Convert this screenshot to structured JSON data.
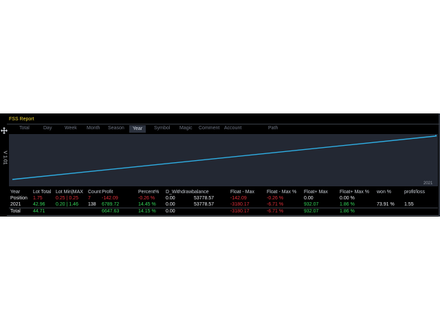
{
  "window": {
    "title": "FSS Report",
    "side_label": "V 1.01"
  },
  "tabs": [
    {
      "label": "Total"
    },
    {
      "label": "Day"
    },
    {
      "label": "Week"
    },
    {
      "label": "Month"
    },
    {
      "label": "Season"
    },
    {
      "label": "Year",
      "active": true
    },
    {
      "label": "Symbol"
    },
    {
      "label": "Magic"
    },
    {
      "label": "Comment"
    },
    {
      "label": "Account"
    },
    {
      "label": "Path"
    }
  ],
  "chart": {
    "x_tick": "2021",
    "line_color": "#2fb0e6",
    "trend": "rising"
  },
  "table": {
    "headers": [
      "Year",
      "Lot Total",
      "Lot Min|MAX",
      "Count",
      "Profit",
      "Percent%",
      "D_Withdrawbalance",
      "Float - Max",
      "Float - Max %",
      "Float+ Max",
      "Float+ Max %",
      "won %",
      "profit/loss"
    ],
    "rows": [
      {
        "cells": [
          "Position",
          "1.75",
          "0.25 | 0.25",
          "7",
          "-142.09",
          "-0.26 %",
          "0.00",
          "53778.57",
          "-142.09",
          "-0.26 %",
          "0.00",
          "0.00 %",
          "",
          ""
        ],
        "colors": [
          "white",
          "red",
          "red",
          "red",
          "red",
          "red",
          "white",
          "white",
          "red",
          "red",
          "white",
          "white",
          "white",
          "white"
        ]
      },
      {
        "cells": [
          "2021",
          "42.96",
          "0.20 | 1.46",
          "138",
          "6789.72",
          "14.45 %",
          "0.00",
          "53778.57",
          "-3180.17",
          "-6.71 %",
          "932.07",
          "1.86 %",
          "73.91 %",
          "1.55"
        ],
        "colors": [
          "white",
          "green",
          "green",
          "white",
          "green",
          "green",
          "white",
          "white",
          "red",
          "red",
          "green",
          "green",
          "white",
          "white"
        ]
      },
      {
        "cells": [
          "Total",
          "44.71",
          "",
          "",
          "6647.63",
          "14.15 %",
          "0.00",
          "",
          "-3180.17",
          "-6.71 %",
          "932.07",
          "1.86 %",
          "",
          ""
        ],
        "colors": [
          "white",
          "green",
          "white",
          "white",
          "green",
          "green",
          "white",
          "white",
          "red",
          "red",
          "green",
          "green",
          "white",
          "white"
        ]
      }
    ]
  },
  "colors": {
    "title": "#f2d83a",
    "positive": "#36d45a",
    "negative": "#e0303a",
    "background": "#000000",
    "chart_bg": "#232833"
  }
}
